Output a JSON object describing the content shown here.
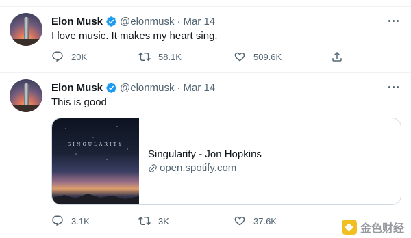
{
  "tweets": [
    {
      "author": {
        "name": "Elon Musk",
        "handle": "@elonmusk"
      },
      "separator": "·",
      "timestamp": "Mar 14",
      "text": "I love music. It makes my heart sing.",
      "stats": {
        "replies": "20K",
        "retweets": "58.1K",
        "likes": "509.6K"
      }
    },
    {
      "author": {
        "name": "Elon Musk",
        "handle": "@elonmusk"
      },
      "separator": "·",
      "timestamp": "Mar 14",
      "text": "This is good",
      "card": {
        "media_title": "SINGULARITY",
        "title": "Singularity - Jon Hopkins",
        "domain": "open.spotify.com"
      },
      "stats": {
        "replies": "3.1K",
        "retweets": "3K",
        "likes": "37.6K"
      }
    }
  ],
  "watermark": {
    "text": "金色财经"
  },
  "icons": [
    "verified-badge-icon",
    "more-icon",
    "reply-icon",
    "retweet-icon",
    "like-icon",
    "share-icon",
    "link-icon"
  ],
  "colors": {
    "verified": "#1d9bf0",
    "muted": "#536471",
    "text": "#0f1419",
    "border": "#cfd9de",
    "watermark_logo": "#f0b90b"
  }
}
